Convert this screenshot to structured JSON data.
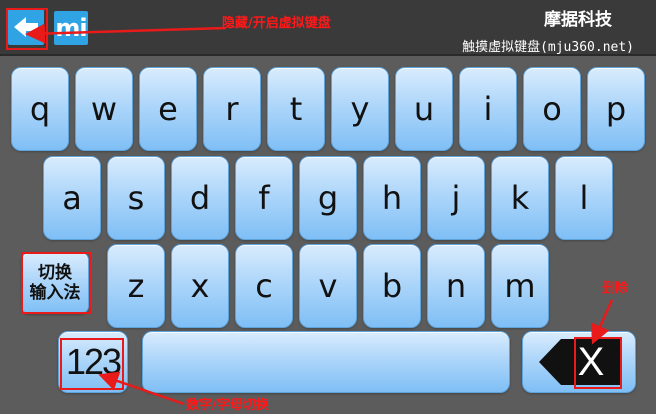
{
  "header": {
    "brand_name": "摩据科技",
    "brand_sub": "触摸虚拟键盘(mju360.net)",
    "logo_text": "mi",
    "hide_button_icon": "back-arrow-icon"
  },
  "keyboard": {
    "row1": [
      "q",
      "w",
      "e",
      "r",
      "t",
      "y",
      "u",
      "i",
      "o",
      "p"
    ],
    "row2": [
      "a",
      "s",
      "d",
      "f",
      "g",
      "h",
      "j",
      "k",
      "l"
    ],
    "row3": [
      "z",
      "x",
      "c",
      "v",
      "b",
      "n",
      "m"
    ],
    "ime_switch_line1": "切换",
    "ime_switch_line2": "输入法",
    "num_toggle": "123",
    "delete_label": "X",
    "space_label": ""
  },
  "annotations": {
    "toggle_keyboard": "隐藏/开启虚拟键盘",
    "delete": "删除",
    "num_letter_switch": "数字/字母切换"
  },
  "colors": {
    "accent": "#2fa3e4",
    "background": "#5c5c5c",
    "topbar": "#3a3a3a",
    "annotation": "#e81a1a"
  }
}
